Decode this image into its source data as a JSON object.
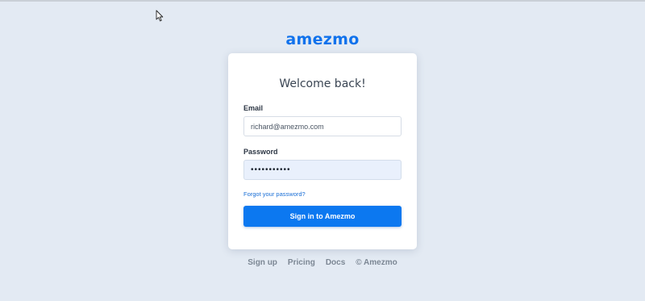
{
  "brand": {
    "logo_text": "amezmo",
    "color": "#1072ec"
  },
  "login": {
    "title": "Welcome back!",
    "email_label": "Email",
    "email_value": "richard@amezmo.com",
    "password_label": "Password",
    "password_value": "•••••••••••",
    "forgot_link": "Forgot your password?",
    "submit_label": "Sign in to Amezmo"
  },
  "footer": {
    "links": [
      "Sign up",
      "Pricing",
      "Docs"
    ],
    "copyright": "© Amezmo"
  },
  "colors": {
    "background": "#e3eaf3",
    "button": "#0c78f0",
    "link": "#1a6fd6"
  },
  "icons": {
    "cursor": "mouse-pointer-icon"
  }
}
